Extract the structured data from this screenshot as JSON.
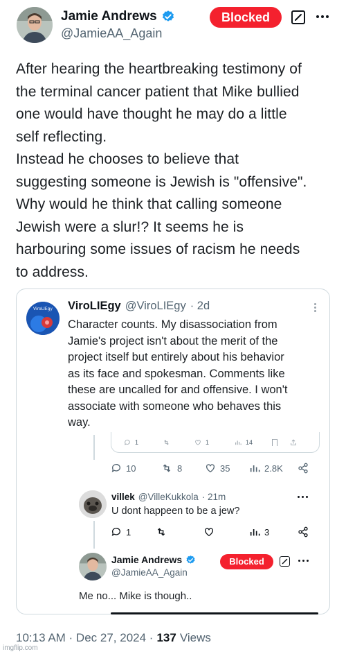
{
  "main_tweet": {
    "author_name": "Jamie Andrews",
    "author_handle": "@JamieAA_Again",
    "blocked_label": "Blocked",
    "text_lines": [
      "After hearing the heartbreaking  testimony of",
      "the terminal cancer patient that Mike bullied",
      "one would have thought he may do a little",
      "self reflecting.",
      "Instead he chooses to believe that",
      "suggesting someone is Jewish is \"offensive\".",
      "Why would he think that calling someone",
      "Jewish were a slur!? It seems he is",
      "harbouring some issues of racism he needs",
      "to address."
    ]
  },
  "quoted": {
    "author_name": "ViroLIEgy",
    "author_handle": "@ViroLIEgy",
    "time": "· 2d",
    "avatar_text": "ViroLIEgy",
    "text_lines": [
      "Character counts. My disassociation from",
      "Jamie's project isn't about the merit of the",
      "project itself but entirely about his behavior",
      "as its face and spokesman. Comments like",
      "these are uncalled for and offensive. I won't",
      "associate with someone who behaves this",
      "way."
    ],
    "partial_actions": {
      "replies": "1",
      "retweets": "",
      "likes": "1",
      "views": "14"
    },
    "actions": {
      "replies": "10",
      "retweets": "8",
      "likes": "35",
      "views": "2.8K"
    },
    "reply": {
      "author_name": "villek",
      "author_handle": "@VilleKukkola",
      "time": "· 21m",
      "text": "U dont happeen to be a jew?",
      "actions": {
        "replies": "1",
        "retweets": "",
        "likes": "",
        "views": "3"
      }
    },
    "nested": {
      "author_name": "Jamie Andrews",
      "author_handle": "@JamieAA_Again",
      "blocked_label": "Blocked",
      "text": "Me no... Mike is though.."
    }
  },
  "footer": {
    "time": "10:13 AM · Dec 27, 2024 ·",
    "views_count": "137",
    "views_label": "Views"
  },
  "watermark": "imgflip.com",
  "colors": {
    "blocked": "#f4212e",
    "verified": "#1d9bf0",
    "muted": "#536471",
    "border": "#cfd9de"
  }
}
